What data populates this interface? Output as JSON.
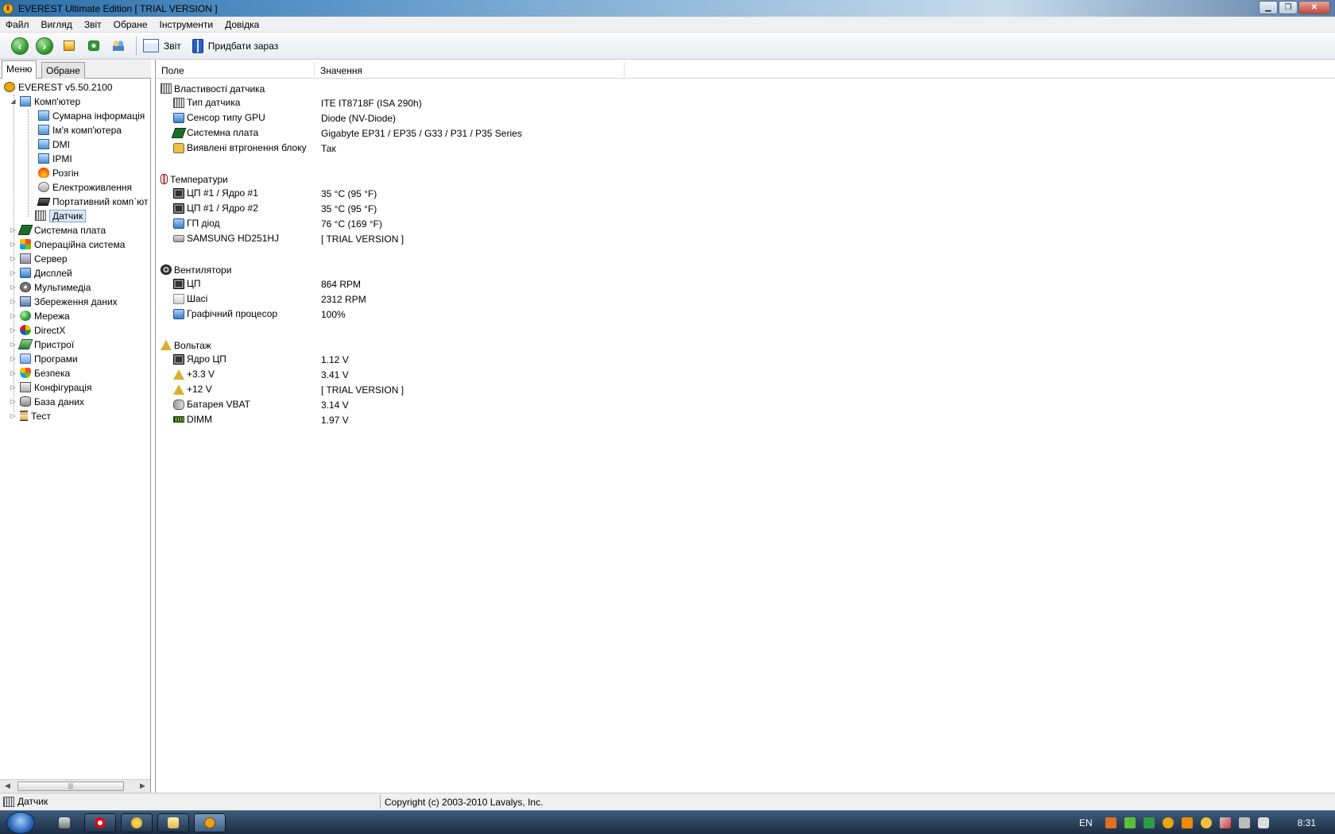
{
  "window": {
    "title": "EVEREST Ultimate Edition  [ TRIAL VERSION ]",
    "controls": [
      "minimize",
      "maximize",
      "close"
    ]
  },
  "menu": [
    "Файл",
    "Вигляд",
    "Звіт",
    "Обране",
    "Інструменти",
    "Довідка"
  ],
  "toolbar": {
    "report_label": "Звіт",
    "buy_label": "Придбати зараз"
  },
  "left_panel": {
    "tabs": [
      "Меню",
      "Обране"
    ],
    "tree": {
      "root": "EVEREST v5.50.2100",
      "computer": "Комп'ютер",
      "computer_children": [
        "Сумарна інформація",
        "Ім'я комп'ютера",
        "DMI",
        "IPMI",
        "Розгін",
        "Електроживлення",
        "Портативний комп`ют",
        "Датчик"
      ],
      "categories": [
        "Системна плата",
        "Операційна система",
        "Сервер",
        "Дисплей",
        "Мультимедіа",
        "Збереження даних",
        "Мережа",
        "DirectX",
        "Пристрої",
        "Програми",
        "Безпека",
        "Конфігурація",
        "База даних",
        "Тест"
      ]
    }
  },
  "columns": [
    "Поле",
    "Значення"
  ],
  "sections": [
    {
      "title": "Властивості датчика",
      "icon": "sensor-icon",
      "rows": [
        {
          "field": "Тип датчика",
          "value": "ITE IT8718F  (ISA 290h)",
          "icon": "sensor-icon"
        },
        {
          "field": "Сенсор типу GPU",
          "value": "Diode  (NV-Diode)",
          "icon": "monitor-icon"
        },
        {
          "field": "Системна плата",
          "value": "Gigabyte EP31 / EP35 / G33 / P31 / P35 Series",
          "icon": "motherboard-icon"
        },
        {
          "field": "Виявлені втргонення блоку",
          "value": "Так",
          "icon": "lock-icon"
        }
      ]
    },
    {
      "title": "Температури",
      "icon": "thermometer-icon",
      "rows": [
        {
          "field": "ЦП #1 / Ядро #1",
          "value": "35 °C  (95 °F)",
          "icon": "cpu-icon"
        },
        {
          "field": "ЦП #1 / Ядро #2",
          "value": "35 °C  (95 °F)",
          "icon": "cpu-icon"
        },
        {
          "field": "ГП діод",
          "value": "76 °C  (169 °F)",
          "icon": "monitor-icon"
        },
        {
          "field": "SAMSUNG HD251HJ",
          "value": "[ TRIAL VERSION ]",
          "icon": "disk-icon"
        }
      ]
    },
    {
      "title": "Вентилятори",
      "icon": "fan-icon",
      "rows": [
        {
          "field": "ЦП",
          "value": "864 RPM",
          "icon": "cpu-icon"
        },
        {
          "field": "Шасі",
          "value": "2312 RPM",
          "icon": "case-icon"
        },
        {
          "field": "Графічний процесор",
          "value": "100%",
          "icon": "monitor-icon"
        }
      ]
    },
    {
      "title": "Вольтаж",
      "icon": "voltage-icon",
      "rows": [
        {
          "field": "Ядро ЦП",
          "value": "1.12 V",
          "icon": "cpu-icon"
        },
        {
          "field": "+3.3 V",
          "value": "3.41 V",
          "icon": "voltage-icon"
        },
        {
          "field": "+12 V",
          "value": "[ TRIAL VERSION ]",
          "icon": "voltage-icon"
        },
        {
          "field": "Батарея VBAT",
          "value": "3.14 V",
          "icon": "battery-icon"
        },
        {
          "field": "DIMM",
          "value": "1.97 V",
          "icon": "ram-icon"
        }
      ]
    }
  ],
  "status": {
    "left": "Датчик",
    "right": "Copyright (c) 2003-2010 Lavalys, Inc."
  },
  "taskbar": {
    "language": "EN",
    "clock": "8:31"
  }
}
